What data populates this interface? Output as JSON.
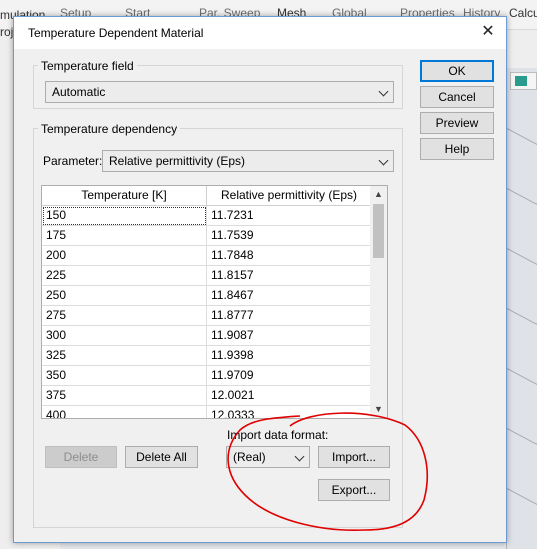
{
  "background": {
    "ribbon_items": [
      "Setup",
      "Start",
      "Par. Sweep",
      "Mesh",
      "Global",
      "Properties",
      "History",
      "Calcu"
    ],
    "left_text_top": "mulation",
    "left_text_bottom": "roje"
  },
  "dialog": {
    "title": "Temperature Dependent Material",
    "temperature_field": {
      "group_label": "Temperature field",
      "selected": "Automatic"
    },
    "temperature_dependency": {
      "group_label": "Temperature dependency",
      "parameter_label": "Parameter:",
      "parameter_selected": "Relative permittivity (Eps)",
      "columns": [
        "Temperature [K]",
        "Relative permittivity (Eps)"
      ],
      "rows": [
        [
          "150",
          "11.7231"
        ],
        [
          "175",
          "11.7539"
        ],
        [
          "200",
          "11.7848"
        ],
        [
          "225",
          "11.8157"
        ],
        [
          "250",
          "11.8467"
        ],
        [
          "275",
          "11.8777"
        ],
        [
          "300",
          "11.9087"
        ],
        [
          "325",
          "11.9398"
        ],
        [
          "350",
          "11.9709"
        ],
        [
          "375",
          "12.0021"
        ],
        [
          "400",
          "12.0333"
        ]
      ],
      "delete_label": "Delete",
      "delete_all_label": "Delete All",
      "import_format_label": "Import data format:",
      "import_format_selected": "(Real)",
      "import_label": "Import...",
      "export_label": "Export..."
    },
    "buttons": {
      "ok": "OK",
      "cancel": "Cancel",
      "preview": "Preview",
      "help": "Help"
    }
  },
  "colors": {
    "accent": "#0078d7",
    "annotation": "#e00000"
  }
}
